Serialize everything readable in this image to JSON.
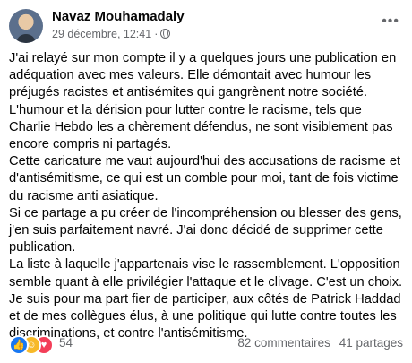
{
  "post": {
    "author": "Navaz Mouhamadaly",
    "date": "29 décembre, 12:41",
    "separator": "·",
    "visibility_icon": "globe-icon",
    "more_icon": "ellipsis-icon",
    "paragraphs": [
      "J'ai relayé sur mon compte il y a quelques jours une publication en adéquation avec mes valeurs. Elle démontait avec humour les préjugés racistes et antisémites qui gangrènent notre société. L'humour et la dérision pour lutter contre le racisme, tels que Charlie Hebdo les a chèrement défendus, ne sont visiblement pas encore compris ni partagés.",
      "Cette caricature me vaut aujourd'hui des accusations de racisme et d'antisémitisme, ce qui est un comble pour moi, tant de fois victime du racisme anti asiatique.",
      "Si ce partage a pu créer de l'incompréhension ou blesser des gens, j'en suis parfaitement navré. J'ai donc décidé de supprimer cette publication.",
      " La liste à laquelle j'appartenais vise le rassemblement. L'opposition semble quant à elle privilégier l'attaque et le clivage. C'est un choix.",
      " Je suis pour ma part fier de participer, aux côtés de Patrick Haddad et de mes collègues élus, à une politique qui lutte contre toutes les discriminations, et contre l'antisémitisme."
    ]
  },
  "footer": {
    "reactions": [
      "like",
      "care",
      "love"
    ],
    "reaction_count": "54",
    "comments": "82 commentaires",
    "shares": "41 partages"
  },
  "colors": {
    "like": "#1877f2",
    "care": "#f7b928",
    "love": "#f33e58",
    "secondary_text": "#65676b"
  }
}
